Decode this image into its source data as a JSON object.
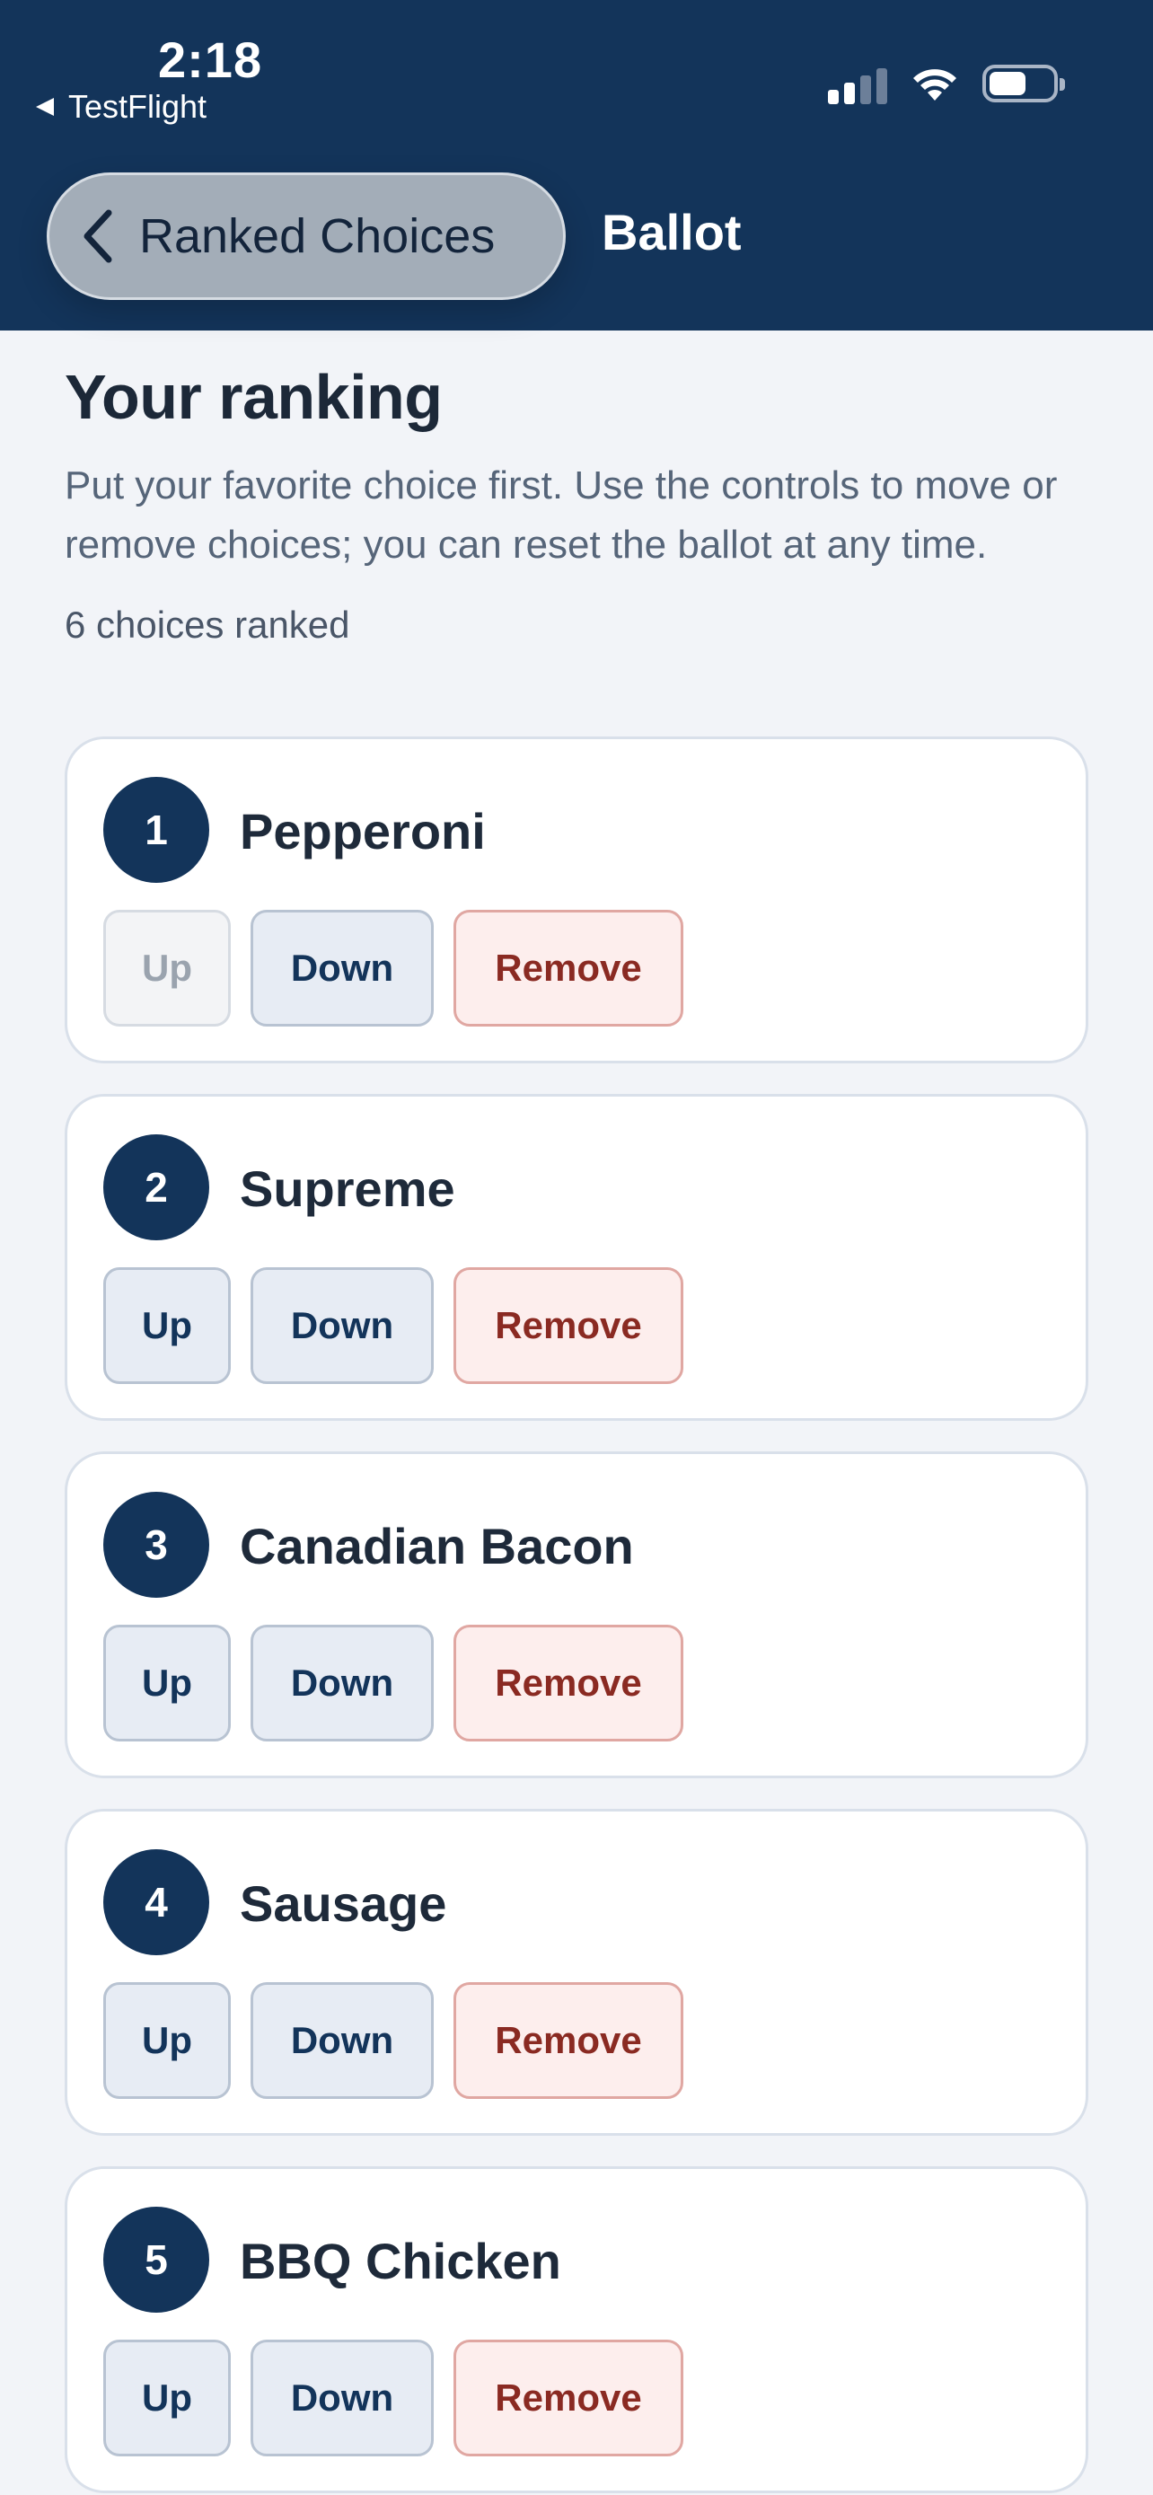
{
  "status_bar": {
    "time": "2:18",
    "back_app": "TestFlight"
  },
  "nav": {
    "back_label": "Ranked Choices",
    "title": "Ballot"
  },
  "main": {
    "title": "Your ranking",
    "description": "Put your favorite choice first. Use the controls to move or remove choices; you can reset the ballot at any time.",
    "count_text": "6 choices ranked",
    "buttons": {
      "up": "Up",
      "down": "Down",
      "remove": "Remove"
    },
    "choices": [
      {
        "rank": "1",
        "name": "Pepperoni",
        "up_disabled": true
      },
      {
        "rank": "2",
        "name": "Supreme",
        "up_disabled": false
      },
      {
        "rank": "3",
        "name": "Canadian Bacon",
        "up_disabled": false
      },
      {
        "rank": "4",
        "name": "Sausage",
        "up_disabled": false
      },
      {
        "rank": "5",
        "name": "BBQ Chicken",
        "up_disabled": false
      }
    ]
  },
  "colors": {
    "header_bg": "#13345a",
    "page_bg": "#f2f4f8",
    "remove_text": "#8a2a22"
  }
}
